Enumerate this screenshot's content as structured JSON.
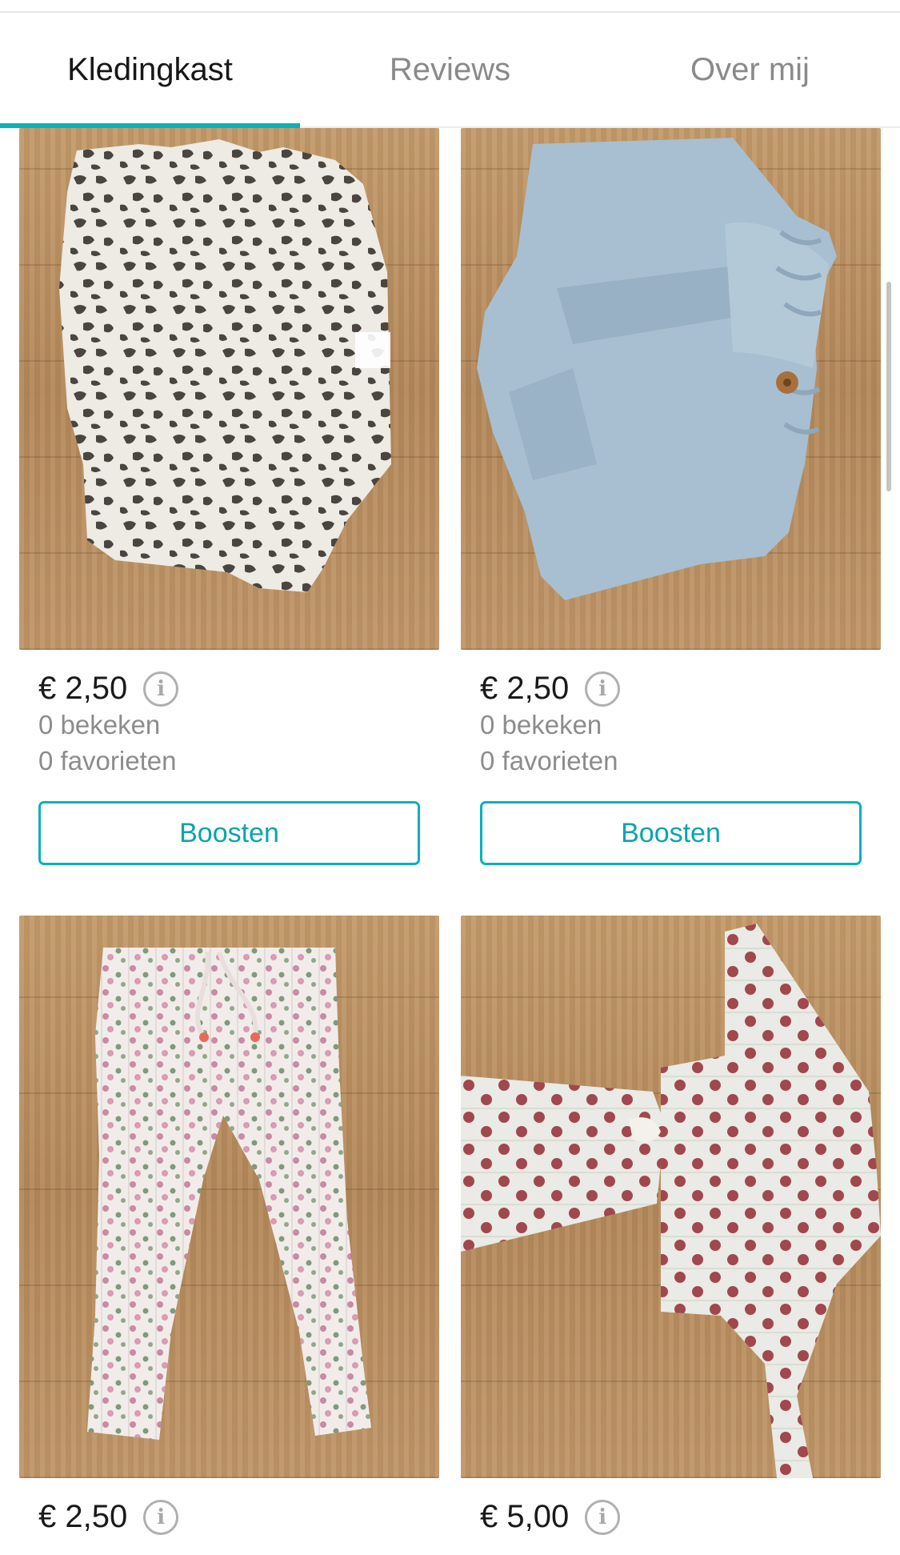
{
  "tabs": [
    {
      "label": "Kledingkast",
      "active": true
    },
    {
      "label": "Reviews",
      "active": false
    },
    {
      "label": "Over mij",
      "active": false
    }
  ],
  "accent_color": "#09b1ba",
  "items": [
    {
      "price": "€ 2,50",
      "views": "0 bekeken",
      "favorites": "0 favorieten",
      "boost_label": "Boosten",
      "photo": "leopard print shirt on wooden floor"
    },
    {
      "price": "€ 2,50",
      "views": "0 bekeken",
      "favorites": "0 favorieten",
      "boost_label": "Boosten",
      "photo": "light blue denim shorts on wooden floor"
    },
    {
      "price": "€ 2,50",
      "photo": "floral ribbed leggings on wooden floor"
    },
    {
      "price": "€ 5,00",
      "photo": "white shirt and pants with red dots on wooden floor"
    }
  ],
  "icons": {
    "info": "info-circle-icon"
  }
}
